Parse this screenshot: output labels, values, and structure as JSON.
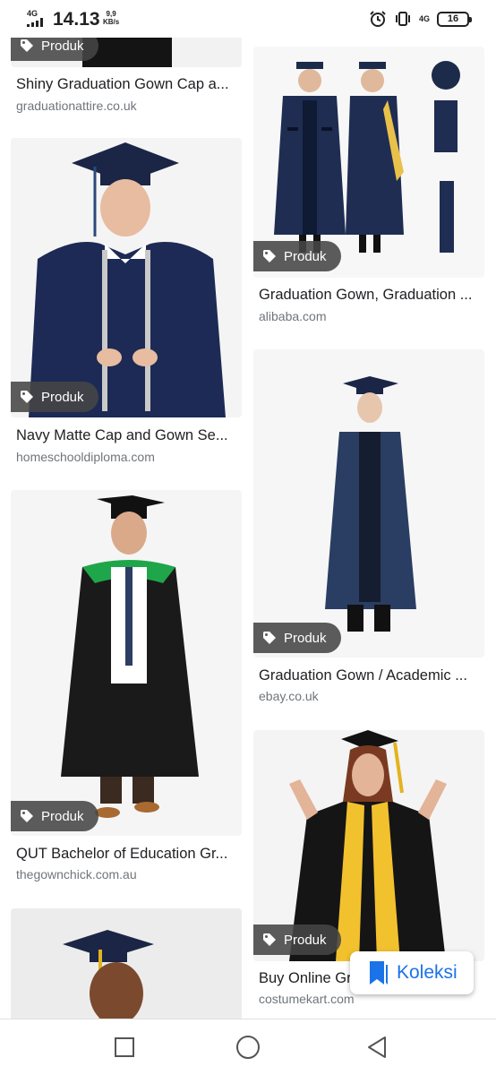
{
  "status_bar": {
    "network_left": "4G",
    "time": "14.13",
    "speed_value": "9,9",
    "speed_unit": "KB/s",
    "network_right": "4G",
    "battery": "16",
    "icons": [
      "signal-icon",
      "alarm-icon",
      "vibrate-icon",
      "battery-icon"
    ]
  },
  "results": [
    {
      "badge": "Produk",
      "title": "Shiny Graduation Gown Cap a...",
      "source": "graduationattire.co.uk"
    },
    {
      "badge": "Produk",
      "title": "Graduation Gown, Graduation ...",
      "source": "alibaba.com"
    },
    {
      "badge": "Produk",
      "title": "Navy Matte Cap and Gown Se...",
      "source": "homeschooldiploma.com"
    },
    {
      "badge": "Produk",
      "title": "Graduation Gown / Academic ...",
      "source": "ebay.co.uk"
    },
    {
      "badge": "Produk",
      "title": "QUT Bachelor of Education Gr...",
      "source": "thegownchick.com.au"
    },
    {
      "badge": "Produk",
      "title": "Buy Online Gr",
      "source": "costumekart.com"
    }
  ],
  "koleksi": {
    "label": "Koleksi",
    "color": "#1a73e8"
  },
  "nav": {
    "buttons": [
      "recents-button",
      "home-button",
      "back-button"
    ]
  },
  "colors": {
    "badge_bg": "#464646",
    "title": "#202124",
    "source": "#70757a",
    "accent": "#1a73e8"
  }
}
